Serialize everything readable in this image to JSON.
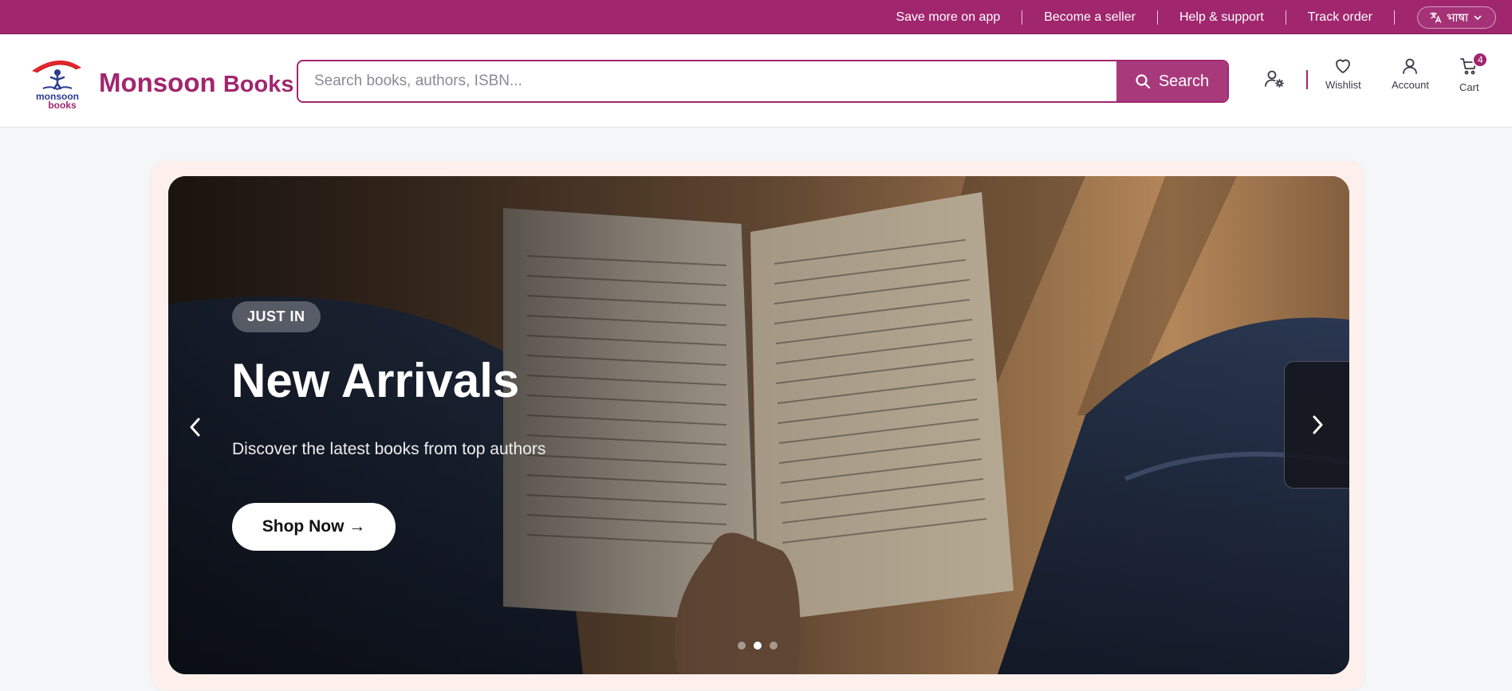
{
  "topbar": {
    "links": [
      "Save more on app",
      "Become a seller",
      "Help & support",
      "Track order"
    ],
    "language_label": "भाषा"
  },
  "brand": {
    "name_part1": "Monsoon",
    "name_part2": "Books",
    "logo_line1": "monsoon",
    "logo_line2": "books"
  },
  "search": {
    "placeholder": "Search books, authors, ISBN...",
    "value": "",
    "button_label": "Search"
  },
  "header_actions": {
    "wishlist_label": "Wishlist",
    "account_label": "Account",
    "cart_label": "Cart",
    "cart_count": "4"
  },
  "hero": {
    "tag": "JUST IN",
    "title": "New Arrivals",
    "subtitle": "Discover the latest books from top authors",
    "cta_label": "Shop Now →",
    "slide_count": 3,
    "active_slide": 2
  },
  "colors": {
    "brand": "#a0266e",
    "search_button": "#a83a7c",
    "hero_frame": "#fdf0ec"
  },
  "icons": [
    "search-icon",
    "seller-settings-icon",
    "heart-icon",
    "user-icon",
    "cart-icon",
    "translate-icon",
    "chevron-down-icon",
    "chevron-left-icon",
    "chevron-right-icon"
  ]
}
